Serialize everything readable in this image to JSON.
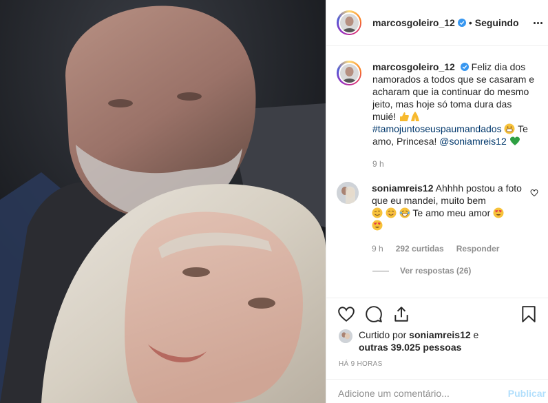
{
  "post": {
    "username": "marcosgoleiro_12",
    "separator": "•",
    "follow_status": "Seguindo"
  },
  "caption": {
    "username": "marcosgoleiro_12",
    "text_1": "Feliz dia dos namorados a todos que se casaram e acharam que ia continuar do mesmo jeito, mas hoje só toma dura das muié!",
    "hashtag": "#tamojuntoseuspaumandados",
    "text_2": "Te amo, Princesa!",
    "mention": "@soniamreis12",
    "time": "9 h"
  },
  "comment": {
    "username": "soniamreis12",
    "text_1": "Ahhhh postou a foto que eu mandei, muito bem",
    "text_2": "Te amo meu amor",
    "time": "9 h",
    "likes": "292 curtidas",
    "reply": "Responder",
    "view_replies": "Ver respostas (26)"
  },
  "likes": {
    "prefix": "Curtido por",
    "user": "soniamreis12",
    "conj": "e",
    "others": "outras 39.025 pessoas"
  },
  "timestamp": "HÁ 9 HORAS",
  "add_comment": {
    "placeholder": "Adicione um comentário...",
    "button": "Publicar"
  },
  "icons": {
    "more": "more-options-icon",
    "verified": "verified-badge-icon",
    "like": "heart-icon",
    "comment": "comment-icon",
    "share": "share-icon",
    "save": "bookmark-icon"
  },
  "colors": {
    "text": "#262626",
    "muted": "#8e8e8e",
    "link": "#00376b",
    "verified": "#3897f0",
    "publish_disabled": "#b2dffc"
  }
}
